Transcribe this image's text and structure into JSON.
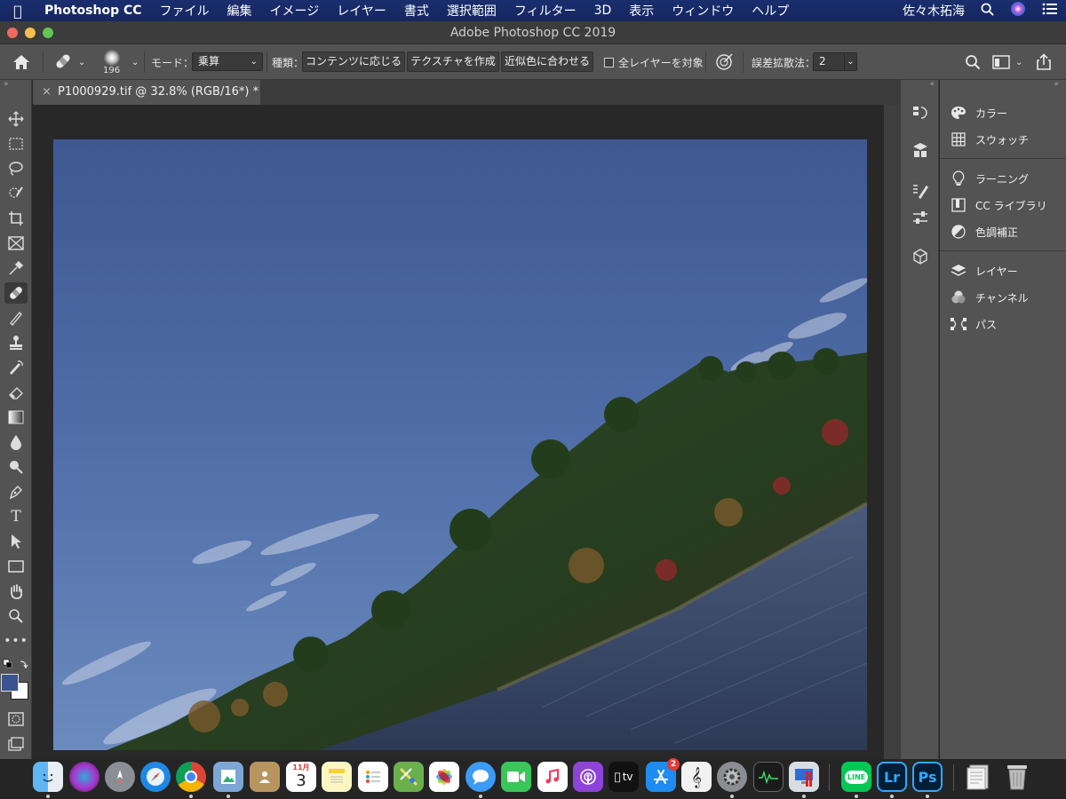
{
  "menubar": {
    "app_name": "Photoshop CC",
    "items": [
      "ファイル",
      "編集",
      "イメージ",
      "レイヤー",
      "書式",
      "選択範囲",
      "フィルター",
      "3D",
      "表示",
      "ウィンドウ",
      "ヘルプ"
    ],
    "user": "佐々木拓海"
  },
  "window": {
    "title": "Adobe Photoshop CC 2019"
  },
  "options": {
    "brush_size": "196",
    "mode_label": "モード：",
    "mode_value": "乗算",
    "type_label": "種類：",
    "type_buttons": [
      "コンテンツに応じる",
      "テクスチャを作成",
      "近似色に合わせる"
    ],
    "sample_all_label": "全レイヤーを対象",
    "diffusion_label": "誤差拡散法：",
    "diffusion_value": "2"
  },
  "document": {
    "tab_title": "P1000929.tif @ 32.8% (RGB/16*) *"
  },
  "panels": {
    "items": [
      "カラー",
      "スウォッチ",
      "ラーニング",
      "CC ライブラリ",
      "色調補正",
      "レイヤー",
      "チャンネル",
      "パス"
    ]
  },
  "colors": {
    "foreground": "#3b548f",
    "background": "#ffffff",
    "accent": "#1a2e6e"
  },
  "dock": {
    "calendar_month": "11月",
    "calendar_day": "3",
    "appstore_badge": "2",
    "tv_label": "tv",
    "line_label": "LINE",
    "lr_label": "Lr",
    "ps_label": "Ps"
  }
}
